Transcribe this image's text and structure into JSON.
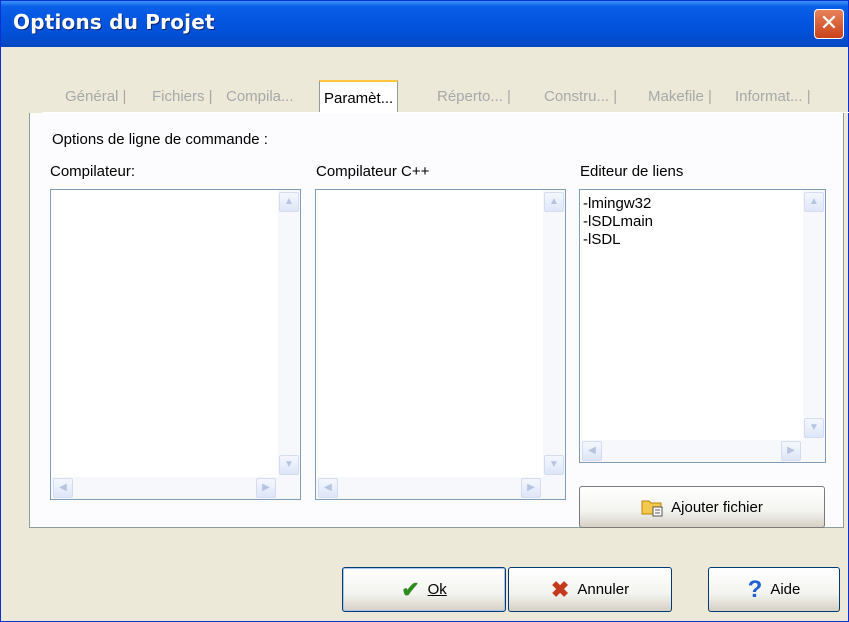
{
  "window": {
    "title": "Options du Projet",
    "close_glyph": "✕"
  },
  "tabs": [
    {
      "label": "Général |",
      "active": false
    },
    {
      "label": "Fichiers |",
      "active": false
    },
    {
      "label": "Compila...",
      "active": false
    },
    {
      "label": "Paramèt...",
      "active": true
    },
    {
      "label": "Réperto... |",
      "active": false
    },
    {
      "label": "Constru... |",
      "active": false
    },
    {
      "label": "Makefile |",
      "active": false
    },
    {
      "label": "Informat... |",
      "active": false
    }
  ],
  "panel": {
    "heading": "Options de ligne de commande :",
    "columns": [
      {
        "label": "Compilateur:",
        "content": ""
      },
      {
        "label": "Compilateur C++",
        "content": ""
      },
      {
        "label": "Editeur de liens",
        "content": "-lmingw32\n-lSDLmain\n-lSDL"
      }
    ],
    "add_file_button": "Ajouter fichier"
  },
  "scroll_glyphs": {
    "up": "▲",
    "down": "▼",
    "left": "◀",
    "right": "▶"
  },
  "buttons": {
    "ok": "Ok",
    "cancel": "Annuler",
    "help": "Aide",
    "ok_icon": "✔",
    "cancel_icon": "✖",
    "help_icon": "?"
  },
  "colors": {
    "ok_icon": "#2e8b1e",
    "cancel_icon": "#c43a1c",
    "help_icon": "#1f5fd6",
    "title_bar": "#0556e0",
    "active_tab_highlight": "#ffc83c"
  },
  "icons": [
    "close-icon",
    "check-icon",
    "cross-icon",
    "help-icon",
    "folder-icon"
  ]
}
